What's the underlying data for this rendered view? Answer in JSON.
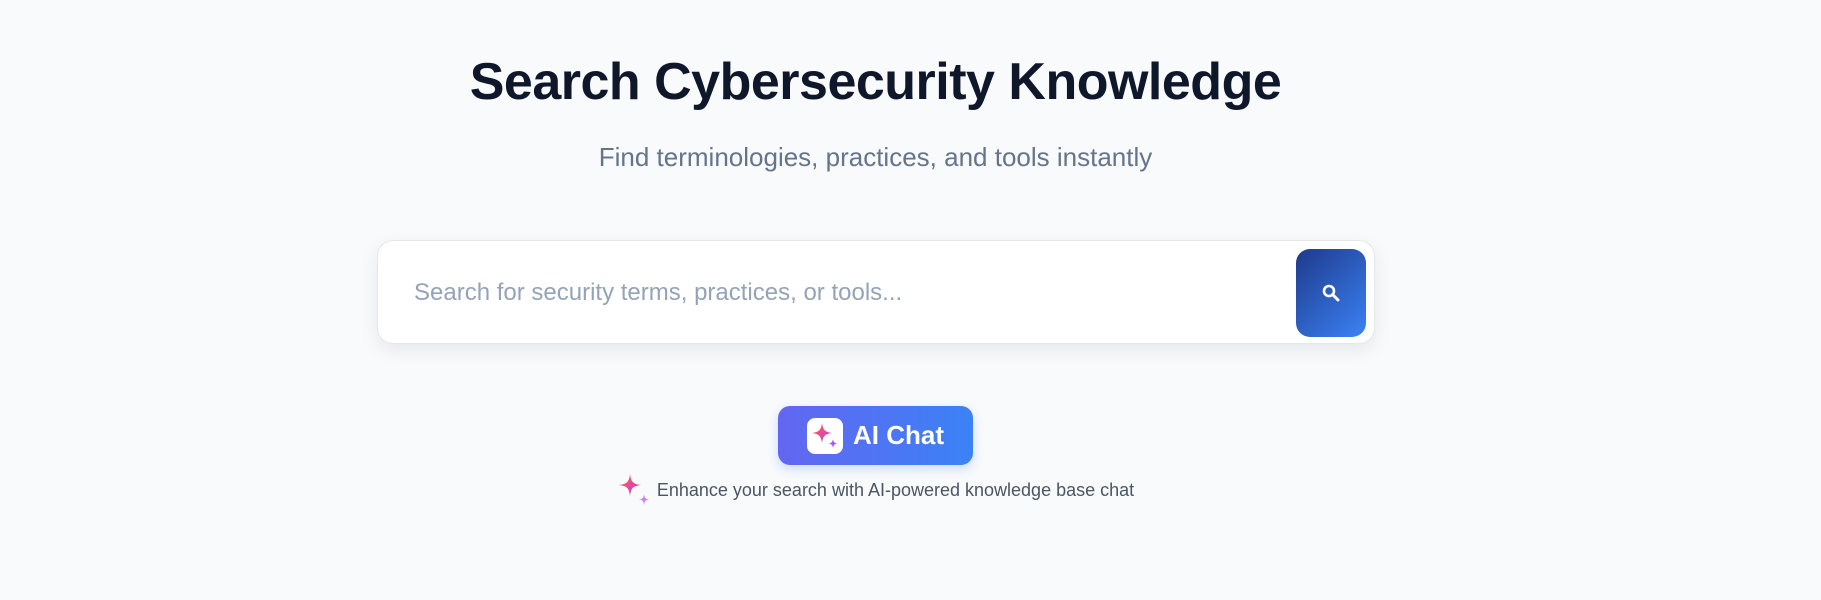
{
  "header": {
    "title": "Search Cybersecurity Knowledge",
    "subtitle": "Find terminologies, practices, and tools instantly"
  },
  "search": {
    "value": "",
    "placeholder": "Search for security terms, practices, or tools...",
    "button_icon": "search-icon"
  },
  "ai_chat": {
    "label": "AI Chat",
    "icon": "sparkle-icon",
    "hint": "Enhance your search with AI-powered knowledge base chat"
  },
  "colors": {
    "background": "#f8fafc",
    "title": "#0f172a",
    "subtitle": "#64748b",
    "search_button_gradient": [
      "#1e3a8a",
      "#3b82f6"
    ],
    "ai_button_gradient": [
      "#6366f1",
      "#3b82f6"
    ]
  }
}
